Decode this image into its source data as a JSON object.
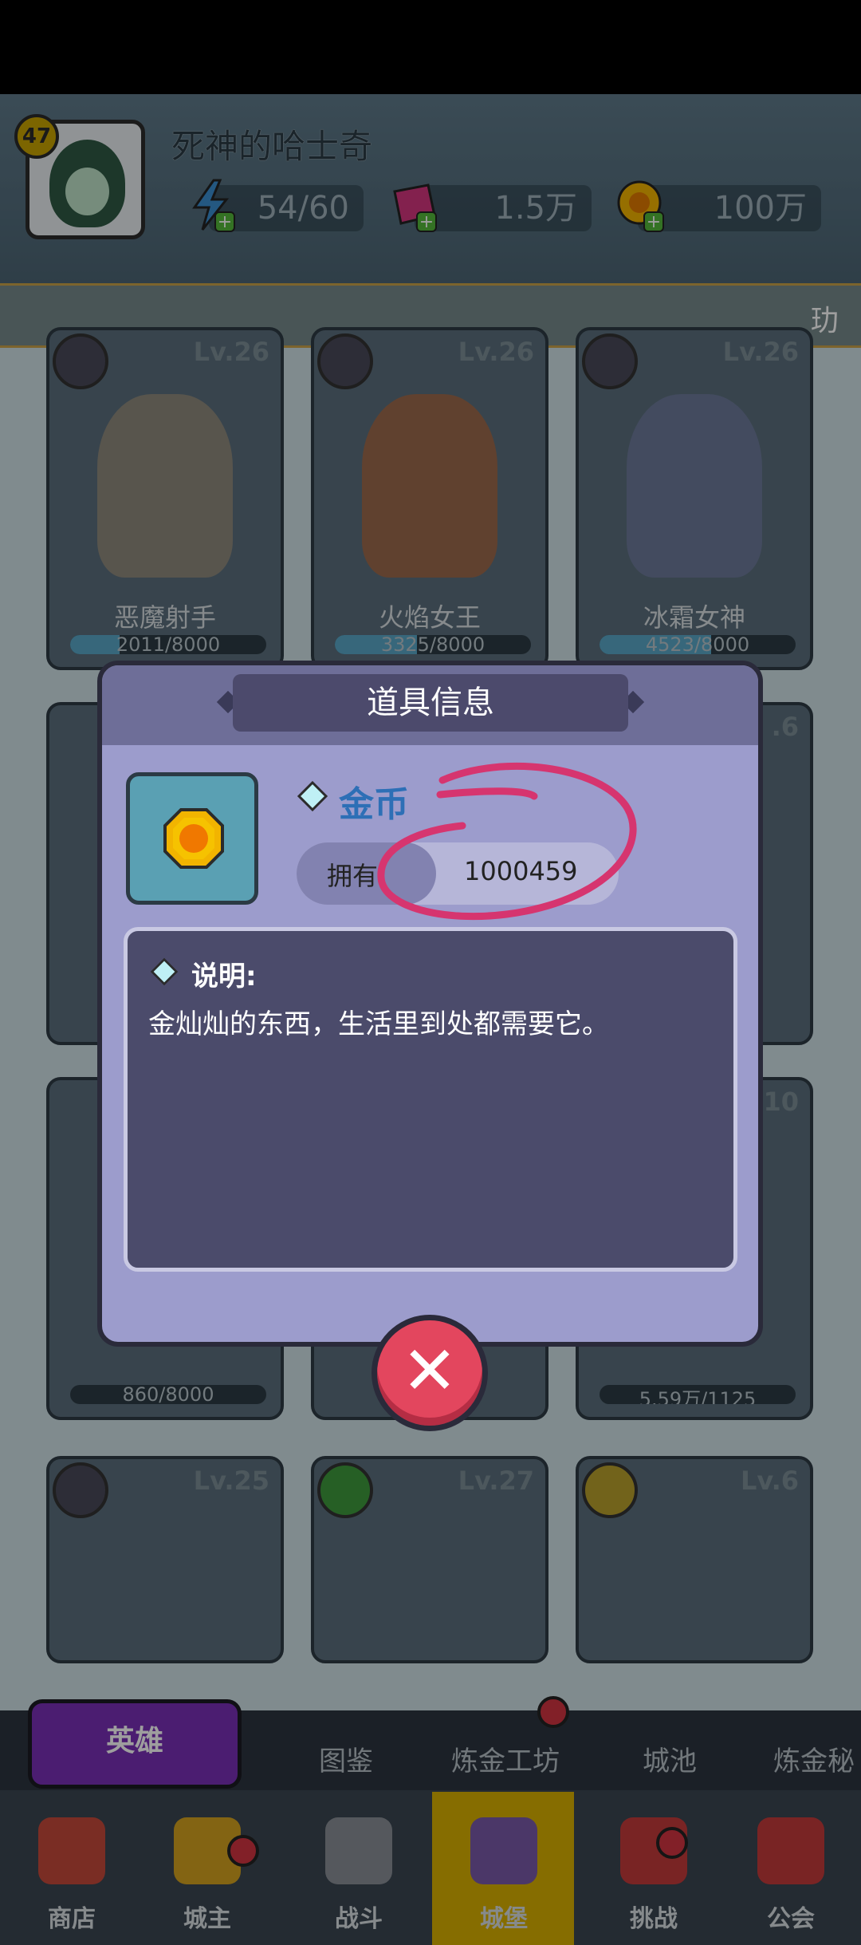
{
  "header": {
    "player_level": "47",
    "player_name": "死神的哈士奇",
    "energy": "54/60",
    "gems": "1.5万",
    "gold": "100万"
  },
  "notice": {
    "text": "玏"
  },
  "heroes": [
    {
      "name": "恶魔射手",
      "level": "Lv.26",
      "progress": "2011/8000",
      "fraction": 0.25
    },
    {
      "name": "火焰女王",
      "level": "Lv.26",
      "progress": "3325/8000",
      "fraction": 0.42
    },
    {
      "name": "冰霜女神",
      "level": "Lv.26",
      "progress": "4523/8000",
      "fraction": 0.57
    }
  ],
  "hidden_row": {
    "left_progress": "860/8000",
    "right_progress": "5.59万/1125",
    "right_level": ".10",
    "mid_level": ".6"
  },
  "bottom_heroes": [
    {
      "level": "Lv.25"
    },
    {
      "level": "Lv.27"
    },
    {
      "level": "Lv.6"
    }
  ],
  "dialog": {
    "title": "道具信息",
    "item_name": "金币",
    "own_label": "拥有",
    "own_value": "1000459",
    "desc_title": "说明:",
    "desc_text": "金灿灿的东西，生活里到处都需要它。",
    "close_icon": "close-x-icon"
  },
  "subtabs": [
    "英雄",
    "图鉴",
    "炼金工坊",
    "城池",
    "炼金秘"
  ],
  "navbar": [
    "商店",
    "城主",
    "战斗",
    "城堡",
    "挑战",
    "公会"
  ],
  "colors": {
    "accent_purple": "#7a2fb6",
    "close_red": "#e3465e",
    "item_blue": "#2d6fb6",
    "castle_yellow": "#d8b100"
  }
}
